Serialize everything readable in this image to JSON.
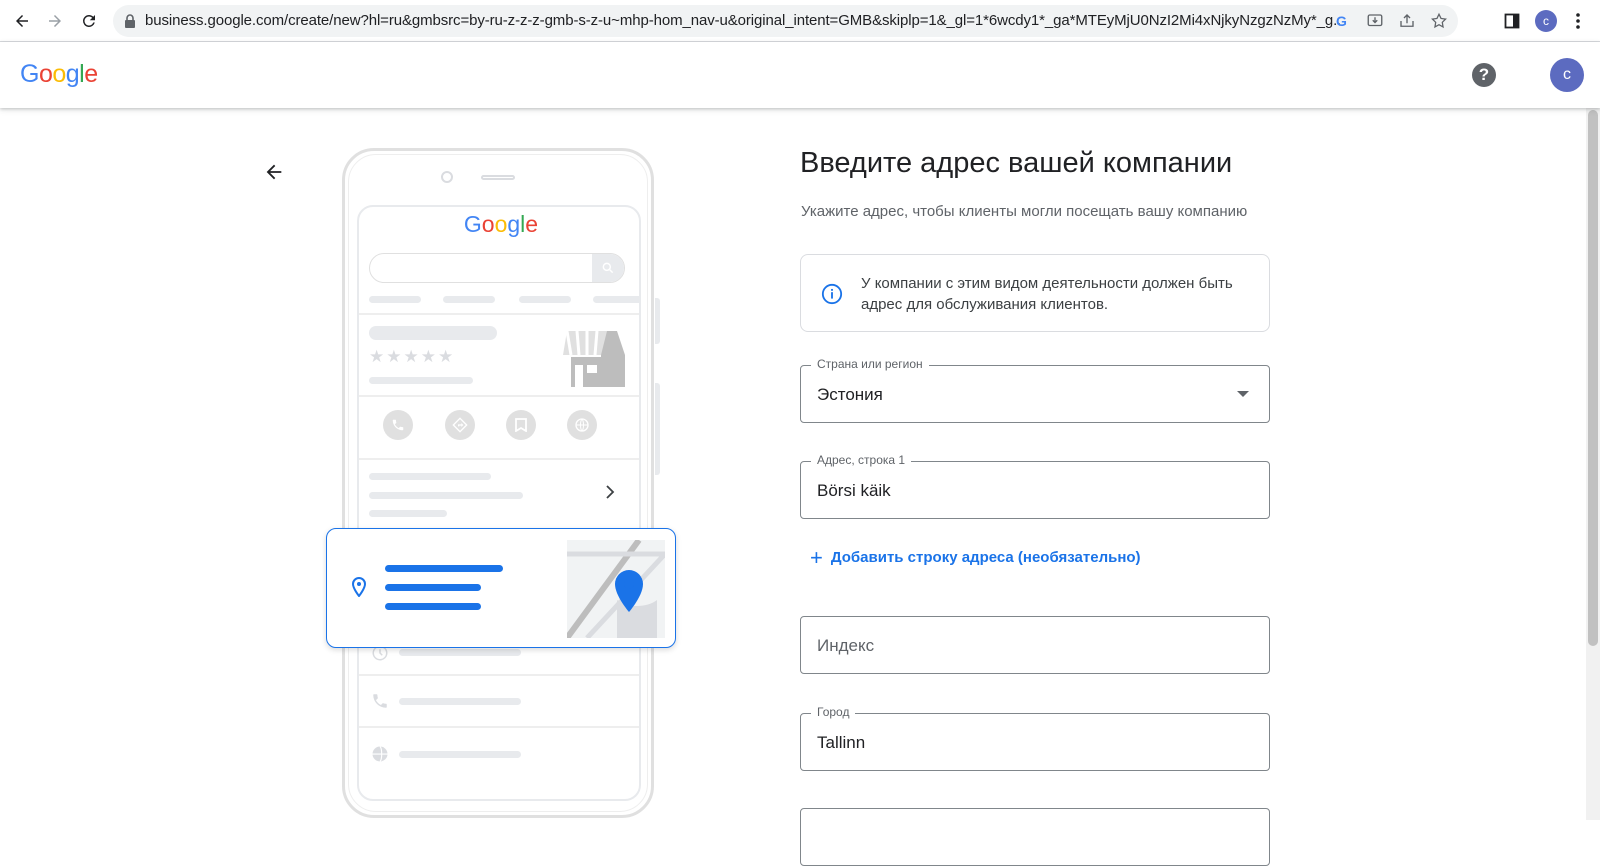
{
  "browser": {
    "url": "business.google.com/create/new?hl=ru&gmbsrc=by-ru-z-z-z-gmb-s-z-u~mhp-hom_nav-u&original_intent=GMB&skiplp=1&_gl=1*6wcdy1*_ga*MTEyMjU0NzI2Mi4xNjkyNzgzNzMy*_g...",
    "profile_initial": "c"
  },
  "header": {
    "logo_text": "Google",
    "help_label": "?",
    "avatar_initial": "c"
  },
  "illustration": {
    "logo_text": "Google"
  },
  "form": {
    "title": "Введите адрес вашей компании",
    "subtitle": "Укажите адрес, чтобы клиенты могли посещать вашу компанию",
    "info_text": "У компании с этим видом деятельности должен быть адрес для обслуживания клиентов.",
    "country": {
      "label": "Страна или регион",
      "value": "Эстония"
    },
    "address1": {
      "label": "Адрес, строка 1",
      "value": "Börsi käik"
    },
    "add_line_label": "Добавить строку адреса (необязательно)",
    "postal": {
      "placeholder": "Индекс"
    },
    "city": {
      "label": "Город",
      "value": "Tallinn"
    }
  },
  "colors": {
    "accent": "#1a73e8",
    "avatar": "#5c6bc0"
  }
}
